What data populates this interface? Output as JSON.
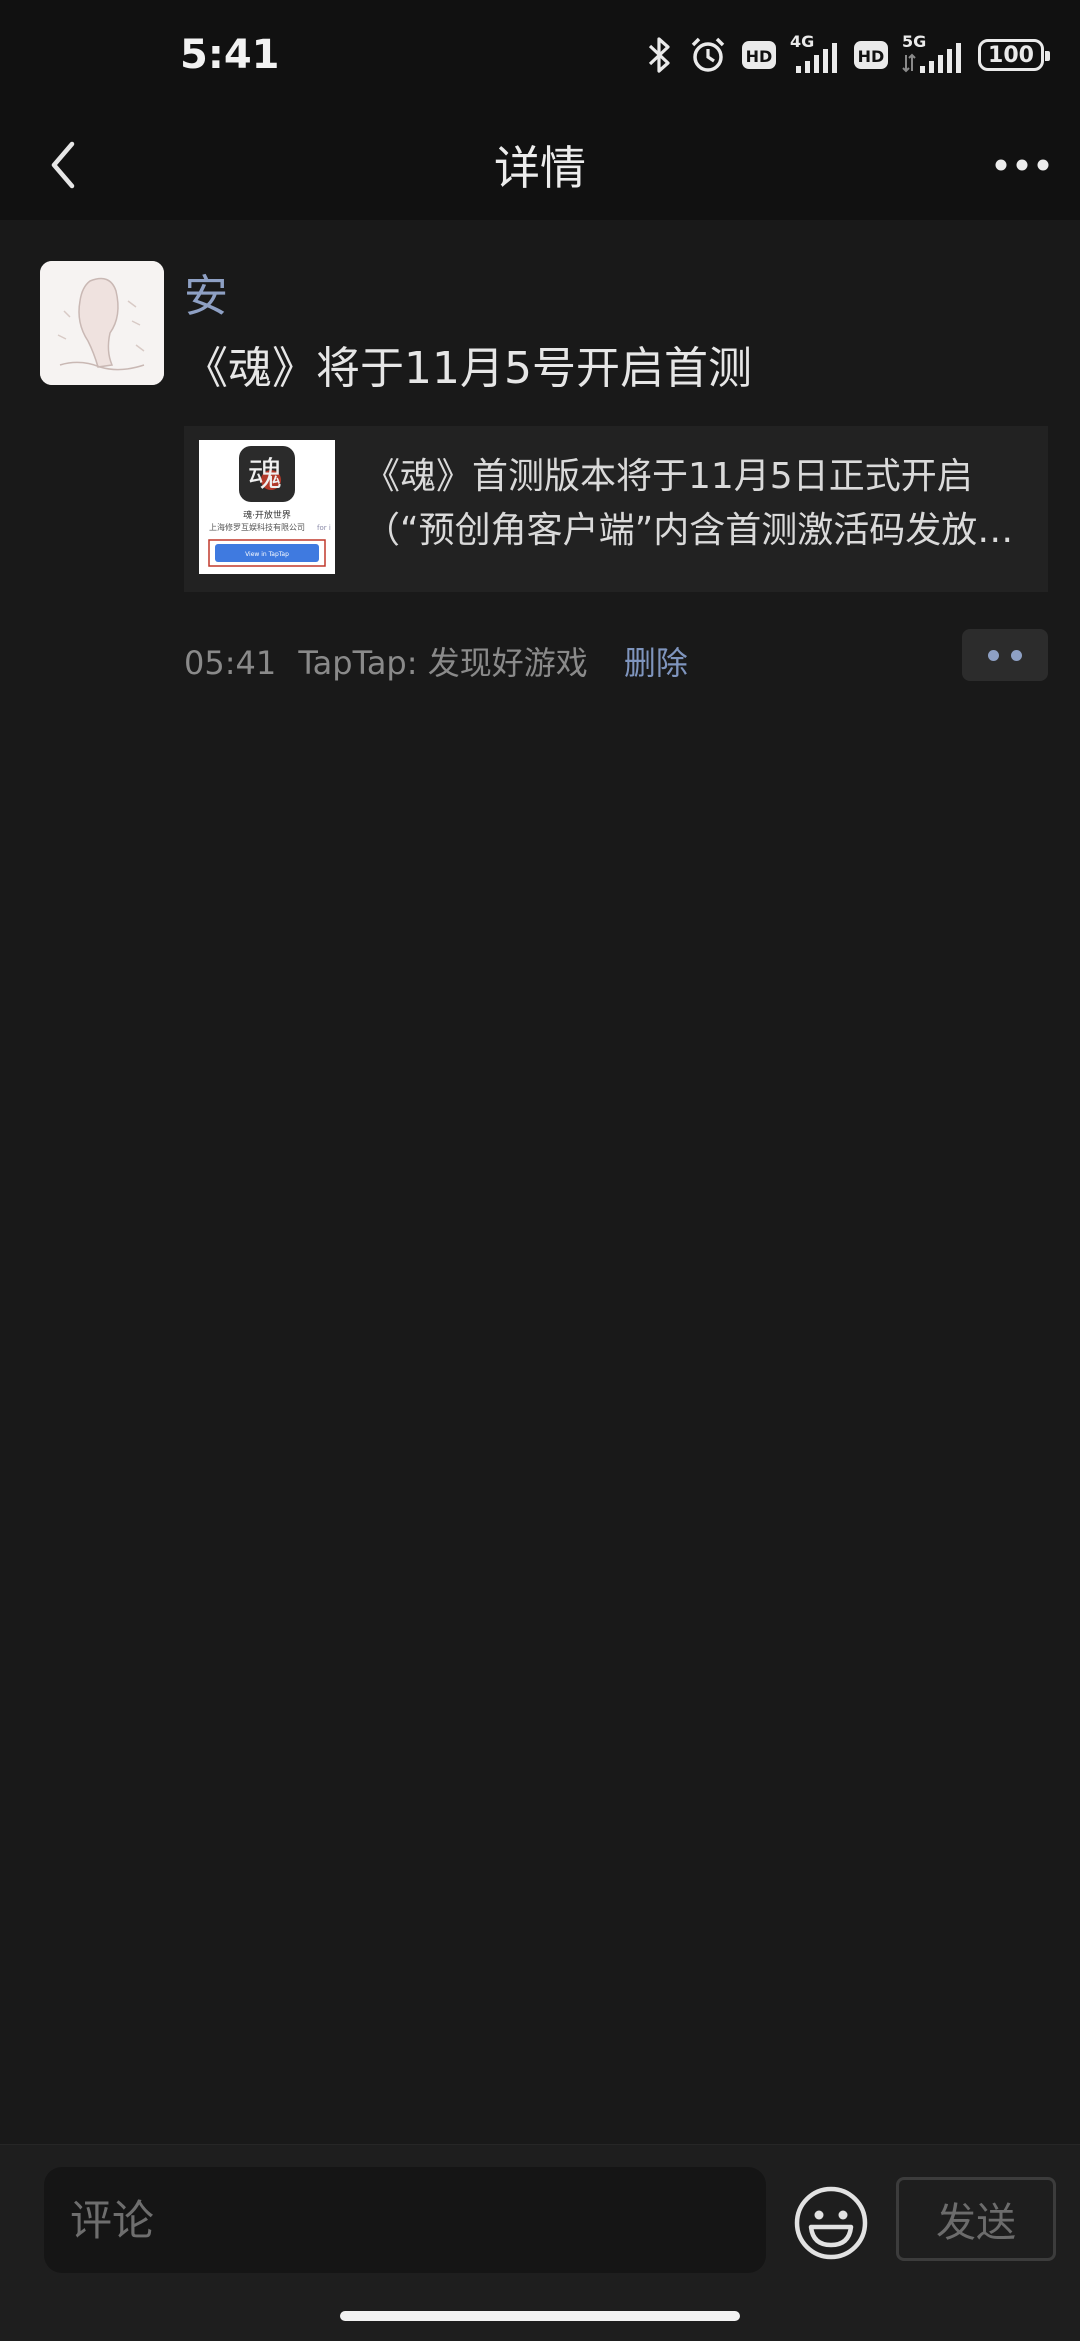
{
  "status_bar": {
    "time": "5:41",
    "hd1": "HD",
    "net1": "4G",
    "hd2": "HD",
    "net2": "5G",
    "battery": "100"
  },
  "nav": {
    "title": "详情",
    "back_icon": "chevron-left-icon",
    "more_icon": "more-dots-icon"
  },
  "post": {
    "author": "安",
    "text": "《魂》将于11月5号开启首测",
    "link_card": {
      "title_line1": "《魂》首测版本将于11月5日正式开启",
      "title_line2": "（“预创角客户端”内含首测激活码发放…",
      "thumb": {
        "logo_char": "魂",
        "caption1": "魂·开放世界",
        "caption2": "上海修罗互娱科技有限公司",
        "caption2_tail": "for i",
        "button": "View in TapTap"
      }
    },
    "time": "05:41",
    "source": "TapTap: 发现好游戏",
    "delete_label": "删除"
  },
  "bottom": {
    "comment_placeholder": "评论",
    "emoji_icon": "emoji-icon",
    "send_label": "发送"
  }
}
